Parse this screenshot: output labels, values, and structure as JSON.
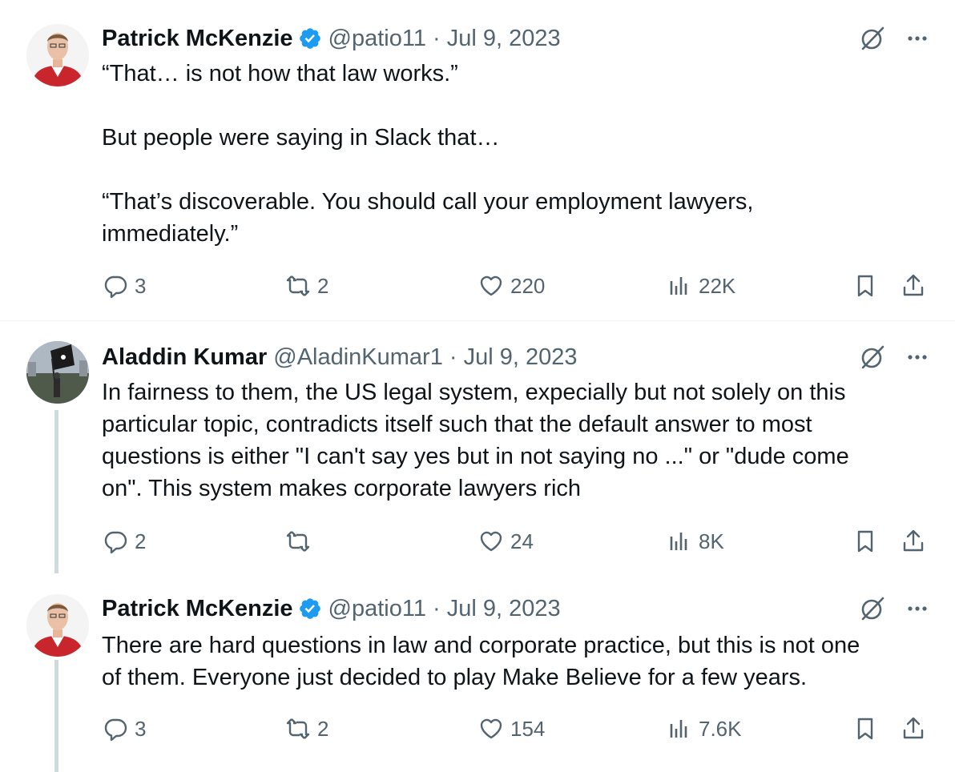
{
  "tweets": [
    {
      "author": "Patrick McKenzie",
      "verified": true,
      "handle_date": "@patio11 · Jul 9, 2023",
      "text": "“That… is not how that law works.”\n\nBut people were saying in Slack that…\n\n“That’s discoverable. You should call your employment lawyers,\nimmediately.”",
      "replies": "3",
      "reposts": "2",
      "likes": "220",
      "views": "22K",
      "avatar": "headshot-red-jacket"
    },
    {
      "author": "Aladdin Kumar",
      "verified": false,
      "handle_date": "@AladinKumar1 · Jul 9, 2023",
      "text": "In fairness to them, the US legal system, expecially but not solely on this\nparticular topic, contradicts itself such that the default answer to most\nquestions is either \"I can't say yes but in not saying no ...\" or \"dude come\non\". This system makes corporate lawyers rich",
      "replies": "2",
      "reposts": "",
      "likes": "24",
      "views": "8K",
      "avatar": "person-holding-flag"
    },
    {
      "author": "Patrick McKenzie",
      "verified": true,
      "handle_date": "@patio11 · Jul 9, 2023",
      "text": "There are hard questions in law and corporate practice, but this is not one\nof them. Everyone just decided to play Make Believe for a few years.",
      "replies": "3",
      "reposts": "2",
      "likes": "154",
      "views": "7.6K",
      "avatar": "headshot-red-jacket"
    }
  ],
  "icons": {
    "verified": "verified-badge-icon",
    "grok": "grok-icon",
    "more": "more-icon",
    "reply": "reply-icon",
    "repost": "repost-icon",
    "like": "heart-icon",
    "views": "views-icon",
    "bookmark": "bookmark-icon",
    "share": "share-icon"
  },
  "colors": {
    "text": "#0f1419",
    "secondary": "#536471",
    "verified": "#1d9bf0",
    "thread_line": "#cfd9de"
  }
}
